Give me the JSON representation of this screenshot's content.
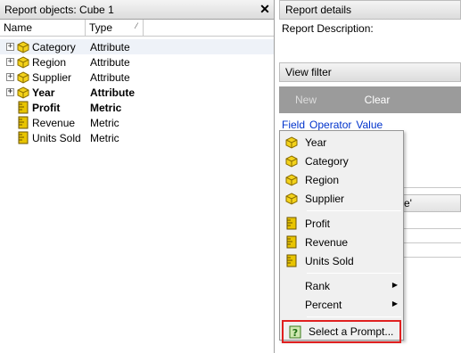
{
  "left_panel": {
    "title": "Report objects: Cube 1",
    "close_label": "✕",
    "columns": {
      "name": "Name",
      "type": "Type",
      "sort_glyph": "⁄"
    },
    "rows": [
      {
        "name": "Category",
        "type": "Attribute",
        "expander": "+",
        "icon": "attribute-cube-icon",
        "bold": false
      },
      {
        "name": "Region",
        "type": "Attribute",
        "expander": "+",
        "icon": "attribute-cube-icon",
        "bold": false
      },
      {
        "name": "Supplier",
        "type": "Attribute",
        "expander": "+",
        "icon": "attribute-cube-icon",
        "bold": false
      },
      {
        "name": "Year",
        "type": "Attribute",
        "expander": "+",
        "icon": "attribute-cube-icon",
        "bold": true
      },
      {
        "name": "Profit",
        "type": "Metric",
        "expander": "",
        "icon": "metric-ruler-icon",
        "bold": true
      },
      {
        "name": "Revenue",
        "type": "Metric",
        "expander": "",
        "icon": "metric-ruler-icon",
        "bold": false
      },
      {
        "name": "Units Sold",
        "type": "Metric",
        "expander": "",
        "icon": "metric-ruler-icon",
        "bold": false
      }
    ]
  },
  "right_panel": {
    "details_header": "Report details",
    "description_label": "Report Description:",
    "view_filter_header": "View filter",
    "toolbar": {
      "new_label": "New",
      "clear_label": "Clear"
    },
    "fov": {
      "field": "Field",
      "operator": "Operator",
      "value": "Value"
    },
    "partial_text": "e'"
  },
  "context_menu": {
    "attributes": [
      "Year",
      "Category",
      "Region",
      "Supplier"
    ],
    "metrics": [
      "Profit",
      "Revenue",
      "Units Sold"
    ],
    "submenus": [
      "Rank",
      "Percent"
    ],
    "prompt_label": "Select a Prompt..."
  },
  "colors": {
    "attribute_icon": "#f3d21a",
    "metric_icon": "#d9b400",
    "highlight_border": "#e02020",
    "link_blue": "#0033cc",
    "toolbar_gray": "#9b9b9b"
  }
}
